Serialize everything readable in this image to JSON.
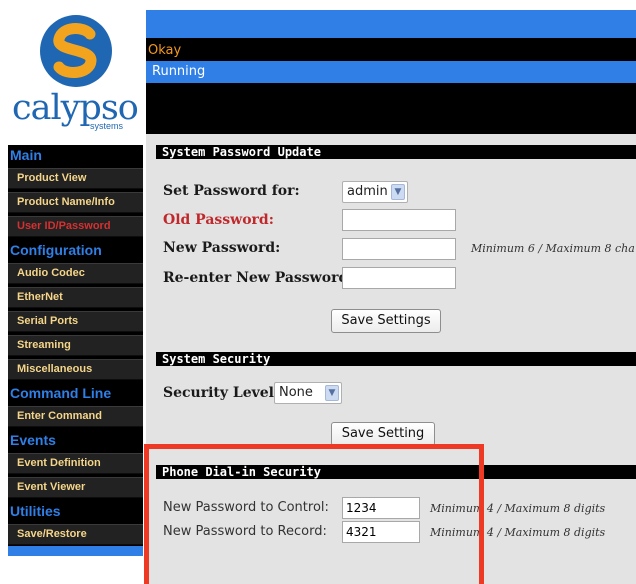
{
  "brand": {
    "wordmark": "calypso",
    "subtitle": "systems",
    "colors": {
      "blue": "#1f67b2",
      "orange": "#f3a41e"
    }
  },
  "status": {
    "message": "Okay",
    "state": "Running"
  },
  "sidebar": {
    "sections": [
      {
        "title": "Main",
        "items": [
          "Product View",
          "Product Name/Info",
          "User ID/Password"
        ]
      },
      {
        "title": "Configuration",
        "items": [
          "Audio Codec",
          "EtherNet",
          "Serial Ports",
          "Streaming",
          "Miscellaneous"
        ]
      },
      {
        "title": "Command Line",
        "items": [
          "Enter Command"
        ]
      },
      {
        "title": "Events",
        "items": [
          "Event Definition",
          "Event Viewer"
        ]
      },
      {
        "title": "Utilities",
        "items": [
          "Save/Restore"
        ]
      }
    ],
    "active_item": "User ID/Password"
  },
  "password_update": {
    "title": "System Password Update",
    "set_for_label": "Set Password for:",
    "set_for_value": "admin",
    "old_label": "Old Password:",
    "new_label": "New Password:",
    "new_hint": "Minimum 6 / Maximum 8 cha",
    "reenter_label": "Re-enter New Password:",
    "save_label": "Save Settings"
  },
  "system_security": {
    "title": "System Security",
    "level_label": "Security Level:",
    "level_value": "None",
    "save_label": "Save Setting"
  },
  "phone_security": {
    "title": "Phone Dial-in Security",
    "control_label": "New Password to Control:",
    "control_value": "1234",
    "control_hint": "Minimum 4 / Maximum 8 digits",
    "record_label": "New Password to Record:",
    "record_value": "4321",
    "record_hint": "Minimum 4 / Maximum 8 digits"
  },
  "annotation_color": "#ee3a24"
}
